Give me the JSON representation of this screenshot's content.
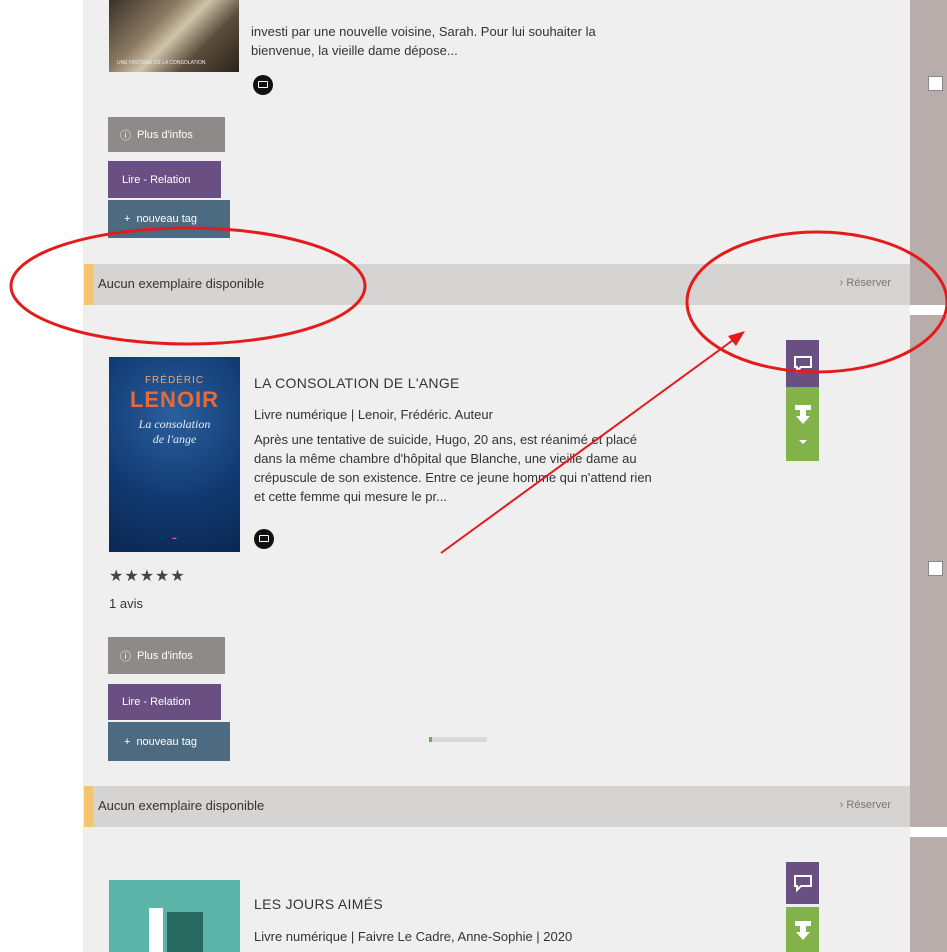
{
  "colors": {
    "annotation": "#e31b1b",
    "purple": "#6a4f82",
    "green": "#82b34a",
    "slate": "#4c6a80",
    "grey": "#8e8a89",
    "availability_bar": "#f6c46c"
  },
  "book1": {
    "cover_caption": "UNE HISTOIRE DE LA CONSOLATION",
    "description_line1": "investi par une nouvelle voisine, Sarah. Pour lui souhaiter la",
    "description_line2": "bienvenue, la vieille dame dépose...",
    "format_icon": "screen-icon",
    "more_info": "Plus d'infos",
    "read_button": "Lire - Relation",
    "tag_button": "nouveau tag",
    "availability": "Aucun exemplaire disponible",
    "reserve": "Réserver"
  },
  "book2": {
    "cover_author_small": "FRÉDÉRIC",
    "cover_author": "LENOIR",
    "cover_title_line1": "La consolation",
    "cover_title_line2": "de l'ange",
    "title": "LA CONSOLATION DE L'ANGE",
    "meta": "Livre numérique | Lenoir, Frédéric. Auteur",
    "description": [
      "Après une tentative de suicide, Hugo, 20 ans, est réanimé et placé",
      "dans la même chambre d'hôpital que Blanche, une vieille dame au",
      "crépuscule de son existence. Entre ce jeune homme qui n'attend rien",
      "et cette femme qui mesure le pr..."
    ],
    "format_icon": "screen-icon",
    "rating": {
      "stars": "★★★★★",
      "value": 5,
      "max": 5
    },
    "reviews": "1 avis",
    "more_info": "Plus d'infos",
    "read_button": "Lire - Relation",
    "tag_button": "nouveau tag",
    "availability": "Aucun exemplaire disponible",
    "reserve": "Réserver",
    "progress_fraction": 0.05
  },
  "book3": {
    "title": "LES JOURS AIMÉS",
    "meta": "Livre numérique | Faivre Le Cadre, Anne-Sophie | 2020"
  }
}
